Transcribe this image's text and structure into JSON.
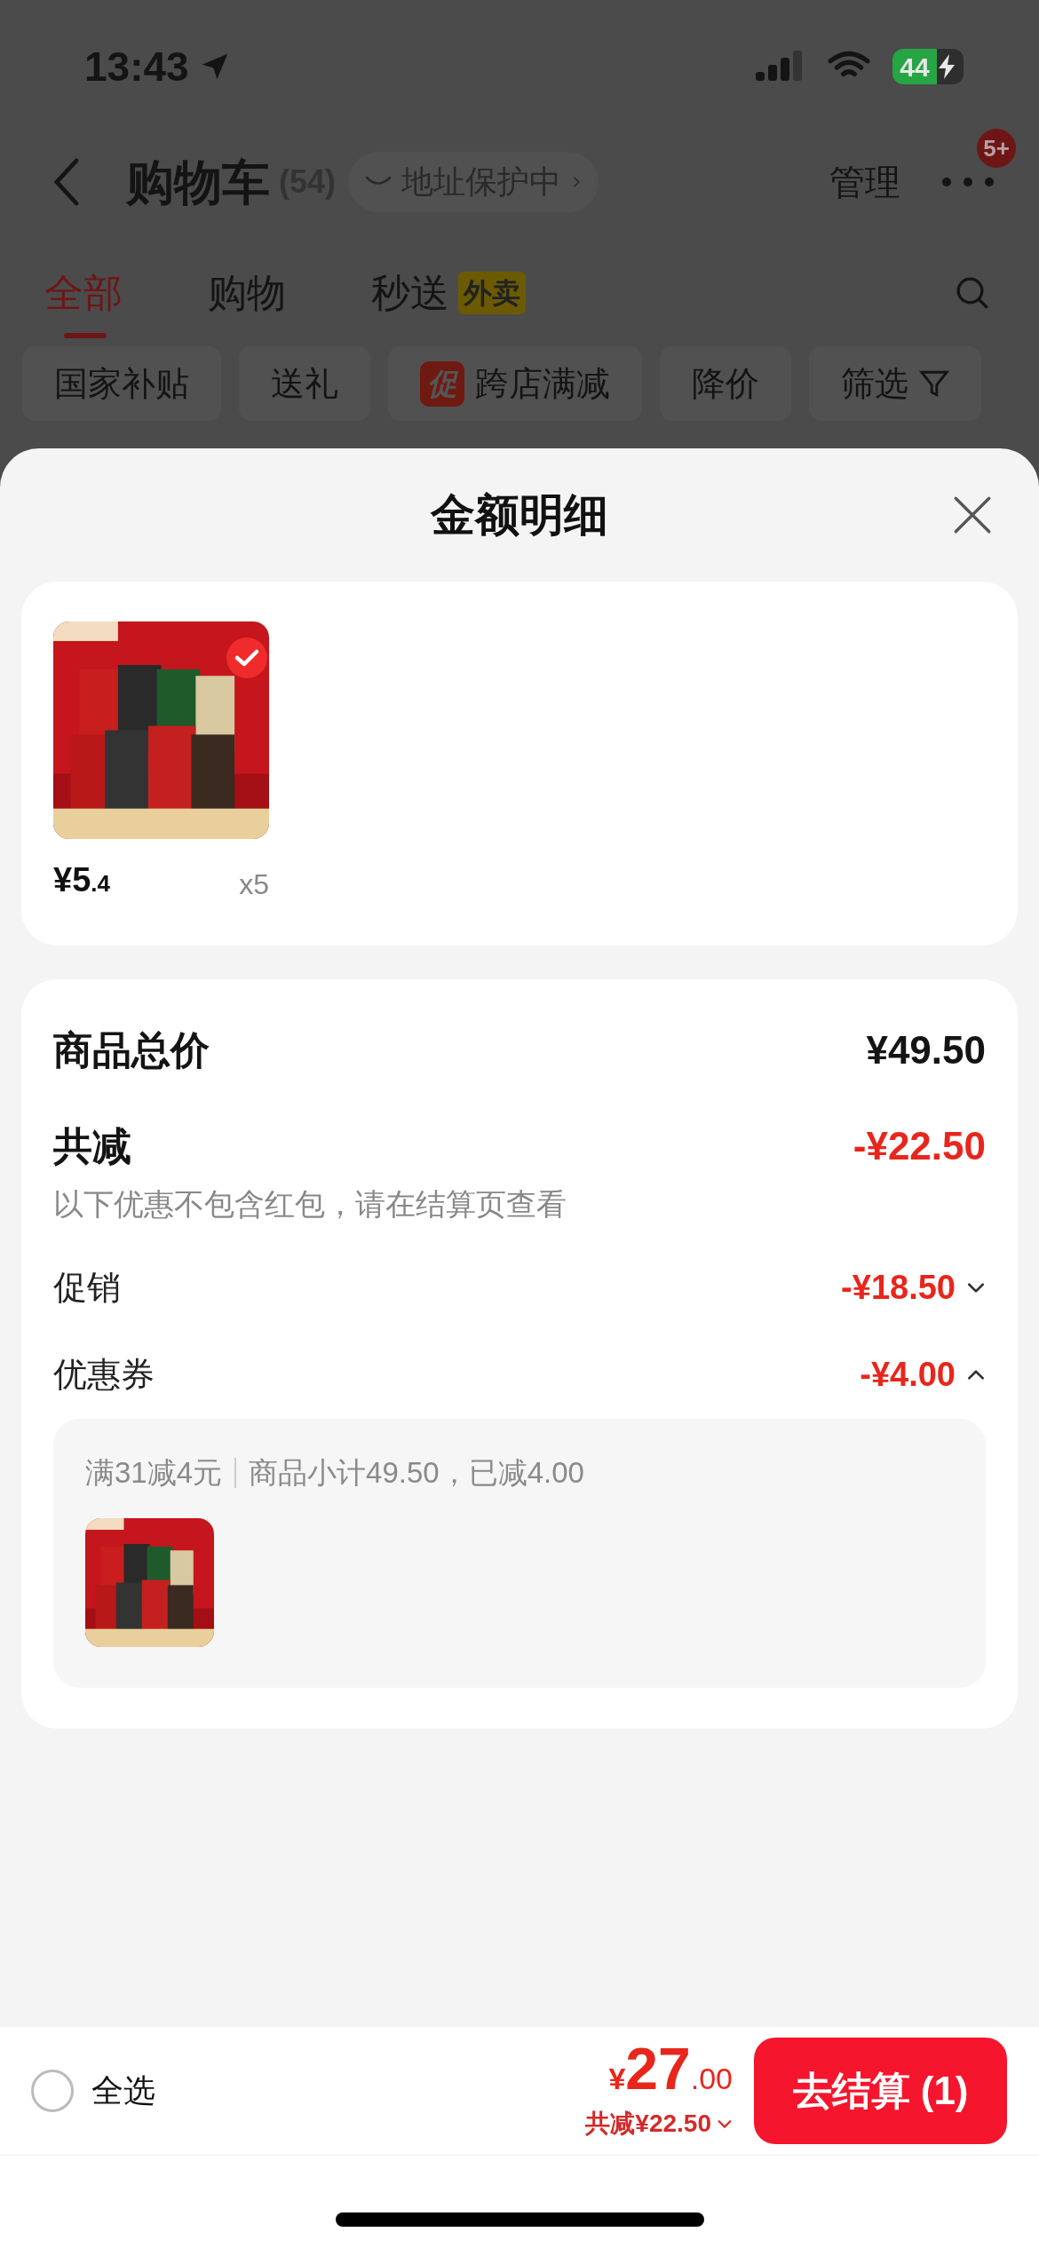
{
  "status_bar": {
    "time": "13:43",
    "battery": "44"
  },
  "header": {
    "title": "购物车",
    "count": "(54)",
    "address_chip": "地址保护中",
    "manage": "管理",
    "badge": "5+"
  },
  "tabs": [
    {
      "label": "全部",
      "selected": true
    },
    {
      "label": "购物",
      "selected": false
    },
    {
      "label": "秒送",
      "tag": "外卖",
      "selected": false
    }
  ],
  "filters": [
    {
      "label": "国家补贴",
      "kind": "plain"
    },
    {
      "label": "送礼",
      "kind": "plain"
    },
    {
      "label": "跨店满减",
      "kind": "promo",
      "tag": "促"
    },
    {
      "label": "降价",
      "kind": "plain"
    },
    {
      "label": "筛选",
      "kind": "filter"
    }
  ],
  "sheet": {
    "title": "金额明细"
  },
  "items": [
    {
      "kind": "picture",
      "price_main": "¥5",
      "price_decimal": ".4",
      "quantity": "x5",
      "checked": true
    }
  ],
  "summary": {
    "total_label": "商品总价",
    "total_value": "¥49.50",
    "discount_label": "共减",
    "discount_value": "-¥22.50",
    "note": "以下优惠不包含红包，请在结算页查看",
    "lines": [
      {
        "label": "促销",
        "value": "-¥18.50",
        "expanded": false
      },
      {
        "label": "优惠券",
        "value": "-¥4.00",
        "expanded": true
      }
    ],
    "coupon_detail": {
      "condition": "满31减4元",
      "subtotal": "商品小计49.50，已减4.00",
      "kind": "picture"
    }
  },
  "bottom_bar": {
    "select_all": {
      "label": "全选",
      "checked": false
    },
    "currency": "¥",
    "total_main": "27",
    "total_decimal": ".00",
    "saved": "共减¥22.50",
    "checkout": "去结算 (1)"
  }
}
